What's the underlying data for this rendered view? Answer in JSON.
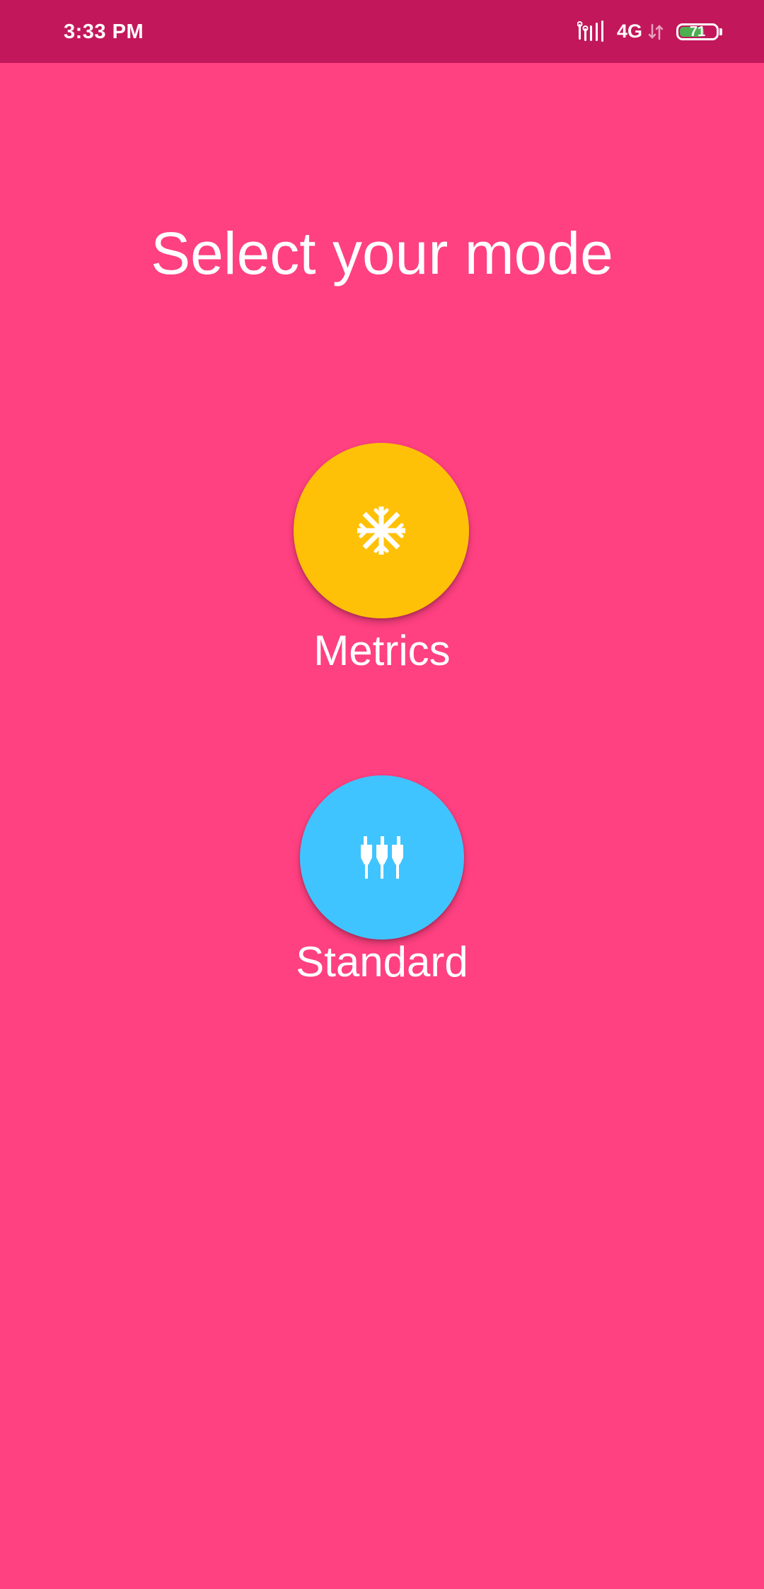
{
  "status_bar": {
    "time": "3:33 PM",
    "network": "4G",
    "battery_level": "71",
    "battery_fraction": 0.71,
    "icons": [
      "signal-icon",
      "data-arrows-icon",
      "battery-icon"
    ]
  },
  "screen": {
    "title": "Select your mode"
  },
  "modes": {
    "metrics": {
      "label": "Metrics",
      "icon": "snowflake-icon",
      "color": "#FFC107"
    },
    "standard": {
      "label": "Standard",
      "icon": "plugs-icon",
      "color": "#40C4FF"
    }
  },
  "colors": {
    "background": "#FF4081",
    "status_bar": "#C2185B",
    "battery_fill": "#4CAF50"
  }
}
